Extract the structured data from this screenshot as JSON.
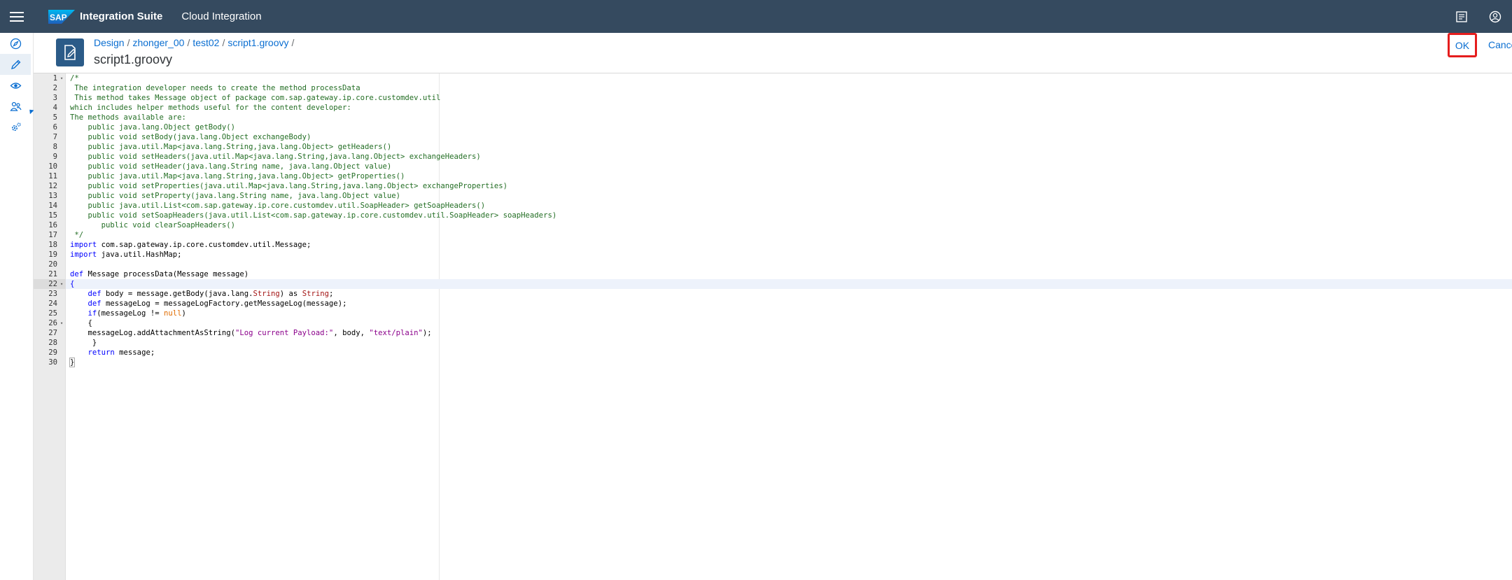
{
  "shell": {
    "product": "Integration Suite",
    "subproduct": "Cloud Integration",
    "logo_text": "SAP"
  },
  "breadcrumb": {
    "items": [
      "Design",
      "zhonger_00",
      "test02",
      "script1.groovy"
    ],
    "trailing_sep": "/"
  },
  "page": {
    "title": "script1.groovy",
    "ok_label": "OK",
    "cancel_label": "Cancel"
  },
  "editor": {
    "current_line": 22,
    "lines": [
      {
        "n": "1",
        "fold": "▾",
        "segs": [
          [
            "c",
            "/*"
          ]
        ]
      },
      {
        "n": "2",
        "segs": [
          [
            "c",
            " The integration developer needs to create the method processData"
          ]
        ]
      },
      {
        "n": "3",
        "segs": [
          [
            "c",
            " This method takes Message object of package com.sap.gateway.ip.core.customdev.util"
          ]
        ]
      },
      {
        "n": "4",
        "segs": [
          [
            "c",
            "which includes helper methods useful for the content developer:"
          ]
        ]
      },
      {
        "n": "5",
        "segs": [
          [
            "c",
            "The methods available are:"
          ]
        ]
      },
      {
        "n": "6",
        "segs": [
          [
            "c",
            "    public java.lang.Object getBody()"
          ]
        ]
      },
      {
        "n": "7",
        "segs": [
          [
            "c",
            "    public void setBody(java.lang.Object exchangeBody)"
          ]
        ]
      },
      {
        "n": "8",
        "segs": [
          [
            "c",
            "    public java.util.Map<java.lang.String,java.lang.Object> getHeaders()"
          ]
        ]
      },
      {
        "n": "9",
        "segs": [
          [
            "c",
            "    public void setHeaders(java.util.Map<java.lang.String,java.lang.Object> exchangeHeaders)"
          ]
        ]
      },
      {
        "n": "10",
        "segs": [
          [
            "c",
            "    public void setHeader(java.lang.String name, java.lang.Object value)"
          ]
        ]
      },
      {
        "n": "11",
        "segs": [
          [
            "c",
            "    public java.util.Map<java.lang.String,java.lang.Object> getProperties()"
          ]
        ]
      },
      {
        "n": "12",
        "segs": [
          [
            "c",
            "    public void setProperties(java.util.Map<java.lang.String,java.lang.Object> exchangeProperties)"
          ]
        ]
      },
      {
        "n": "13",
        "segs": [
          [
            "c",
            "    public void setProperty(java.lang.String name, java.lang.Object value)"
          ]
        ]
      },
      {
        "n": "14",
        "segs": [
          [
            "c",
            "    public java.util.List<com.sap.gateway.ip.core.customdev.util.SoapHeader> getSoapHeaders()"
          ]
        ]
      },
      {
        "n": "15",
        "segs": [
          [
            "c",
            "    public void setSoapHeaders(java.util.List<com.sap.gateway.ip.core.customdev.util.SoapHeader> soapHeaders)"
          ]
        ]
      },
      {
        "n": "16",
        "segs": [
          [
            "c",
            "       public void clearSoapHeaders()"
          ]
        ]
      },
      {
        "n": "17",
        "segs": [
          [
            "c",
            " */"
          ]
        ]
      },
      {
        "n": "18",
        "segs": [
          [
            "k",
            "import"
          ],
          [
            "t",
            " com.sap.gateway.ip.core.customdev.util.Message;"
          ]
        ]
      },
      {
        "n": "19",
        "segs": [
          [
            "k",
            "import"
          ],
          [
            "t",
            " java.util.HashMap;"
          ]
        ]
      },
      {
        "n": "20",
        "segs": []
      },
      {
        "n": "21",
        "segs": [
          [
            "k",
            "def"
          ],
          [
            "t",
            " Message processData(Message message)"
          ]
        ]
      },
      {
        "n": "22",
        "fold": "▾",
        "segs": [
          [
            "k",
            "{"
          ]
        ]
      },
      {
        "n": "23",
        "segs": [
          [
            "t",
            "    "
          ],
          [
            "k",
            "def"
          ],
          [
            "t",
            " body = message.getBody(java.lang."
          ],
          [
            "s",
            "String"
          ],
          [
            "t",
            ") as "
          ],
          [
            "s",
            "String"
          ],
          [
            "t",
            ";"
          ]
        ]
      },
      {
        "n": "24",
        "segs": [
          [
            "t",
            "    "
          ],
          [
            "k",
            "def"
          ],
          [
            "t",
            " messageLog = messageLogFactory.getMessageLog(message);"
          ]
        ]
      },
      {
        "n": "25",
        "segs": [
          [
            "t",
            "    "
          ],
          [
            "k",
            "if"
          ],
          [
            "t",
            "(messageLog != "
          ],
          [
            "nul",
            "null"
          ],
          [
            "t",
            ")"
          ]
        ]
      },
      {
        "n": "26",
        "fold": "▾",
        "segs": [
          [
            "t",
            "    {"
          ]
        ]
      },
      {
        "n": "27",
        "segs": [
          [
            "t",
            "    messageLog.addAttachmentAsString("
          ],
          [
            "str",
            "\"Log current Payload:\""
          ],
          [
            "t",
            ", body, "
          ],
          [
            "str",
            "\"text/plain\""
          ],
          [
            "t",
            ");"
          ]
        ]
      },
      {
        "n": "28",
        "segs": [
          [
            "t",
            "     }"
          ]
        ]
      },
      {
        "n": "29",
        "segs": [
          [
            "t",
            "    "
          ],
          [
            "k",
            "return"
          ],
          [
            "t",
            " message;"
          ]
        ]
      },
      {
        "n": "30",
        "segs": [
          [
            "brace",
            "}"
          ]
        ]
      }
    ]
  }
}
